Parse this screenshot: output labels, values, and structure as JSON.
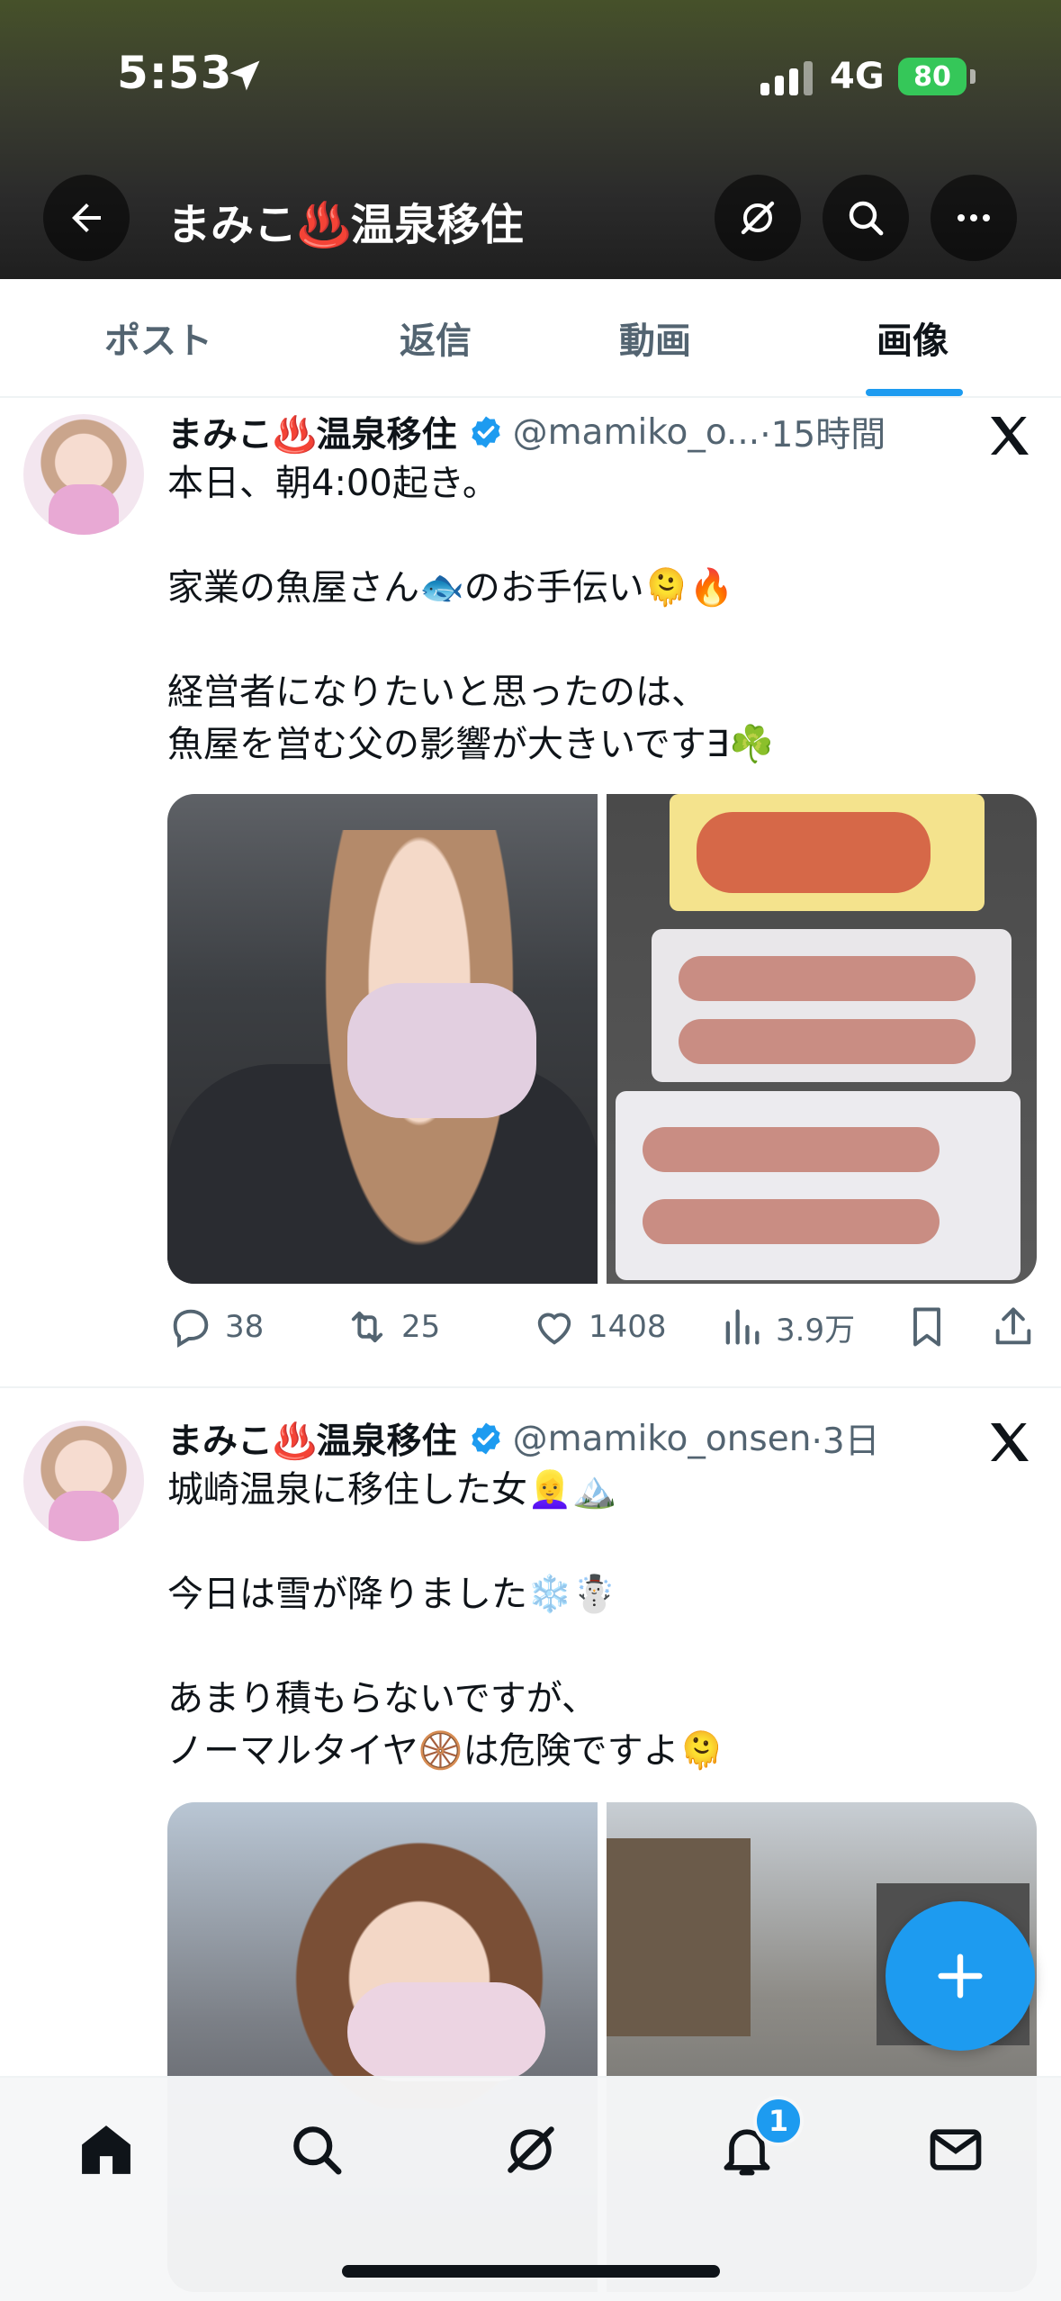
{
  "status_bar": {
    "time": "5:53",
    "network": "4G",
    "battery": "80"
  },
  "header": {
    "title": "まみこ♨️温泉移住"
  },
  "tabs": [
    {
      "label": "ポスト"
    },
    {
      "label": "返信"
    },
    {
      "label": "動画"
    },
    {
      "label": "画像",
      "active": true
    }
  ],
  "posts": [
    {
      "name": "まみこ♨️温泉移住",
      "handle": "@mamiko_o...",
      "time": "·15時間",
      "text": "本日、朝4:00起き。\n\n家業の魚屋さん🐟のお手伝い🫠🔥\n\n経営者になりたいと思ったのは、\n魚屋を営む父の影響が大きいです∃☘️",
      "replies": "38",
      "reposts": "25",
      "likes": "1408",
      "views": "3.9万"
    },
    {
      "name": "まみこ♨️温泉移住",
      "handle": "@mamiko_onsen",
      "time": "·3日",
      "text": "城崎温泉に移住した女👱‍♀️🏔️\n\n今日は雪が降りました❄️☃️\n\nあまり積もらないですが、\nノーマルタイヤ🛞は危険ですよ🫠"
    }
  ],
  "nav": {
    "notification_count": "1"
  },
  "colors": {
    "accent": "#1d9bf0",
    "text": "#0f1419",
    "secondary": "#536471"
  }
}
